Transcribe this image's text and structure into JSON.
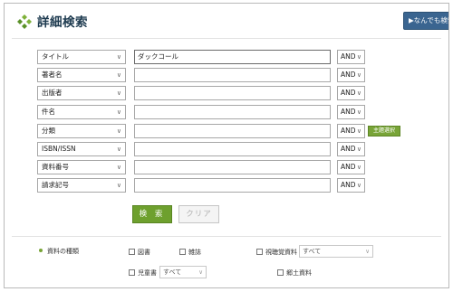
{
  "header": {
    "title": "詳細検索",
    "free_search_button": "▶なんでも検索"
  },
  "search_rows": [
    {
      "field": "タイトル",
      "value": "ダックコール",
      "operator": "AND"
    },
    {
      "field": "著者名",
      "value": "",
      "operator": "AND"
    },
    {
      "field": "出版者",
      "value": "",
      "operator": "AND"
    },
    {
      "field": "件名",
      "value": "",
      "operator": "AND"
    },
    {
      "field": "分類",
      "value": "",
      "operator": "AND",
      "extra_button": "主題選択"
    },
    {
      "field": "ISBN/ISSN",
      "value": "",
      "operator": "AND"
    },
    {
      "field": "資料番号",
      "value": "",
      "operator": "AND"
    },
    {
      "field": "請求記号",
      "value": "",
      "operator": "AND"
    }
  ],
  "actions": {
    "search_label": "検 索",
    "clear_label": "クリア"
  },
  "material_types": {
    "label": "資料の種類",
    "options": [
      {
        "label": "図書",
        "checked": false
      },
      {
        "label": "雑誌",
        "checked": false
      },
      {
        "label": "視聴覚資料",
        "checked": false,
        "select_value": "すべて"
      },
      {
        "label": "児童書",
        "checked": false,
        "select_value": "すべて"
      },
      {
        "label": "郷土資料",
        "checked": false
      }
    ]
  },
  "colors": {
    "accent_green": "#6ea02e",
    "header_button_blue": "#3a6590",
    "title_text": "#1d3a4f"
  },
  "icons": {
    "header": "green-diamond-cluster-icon",
    "dropdown": "chevron-down-icon"
  }
}
